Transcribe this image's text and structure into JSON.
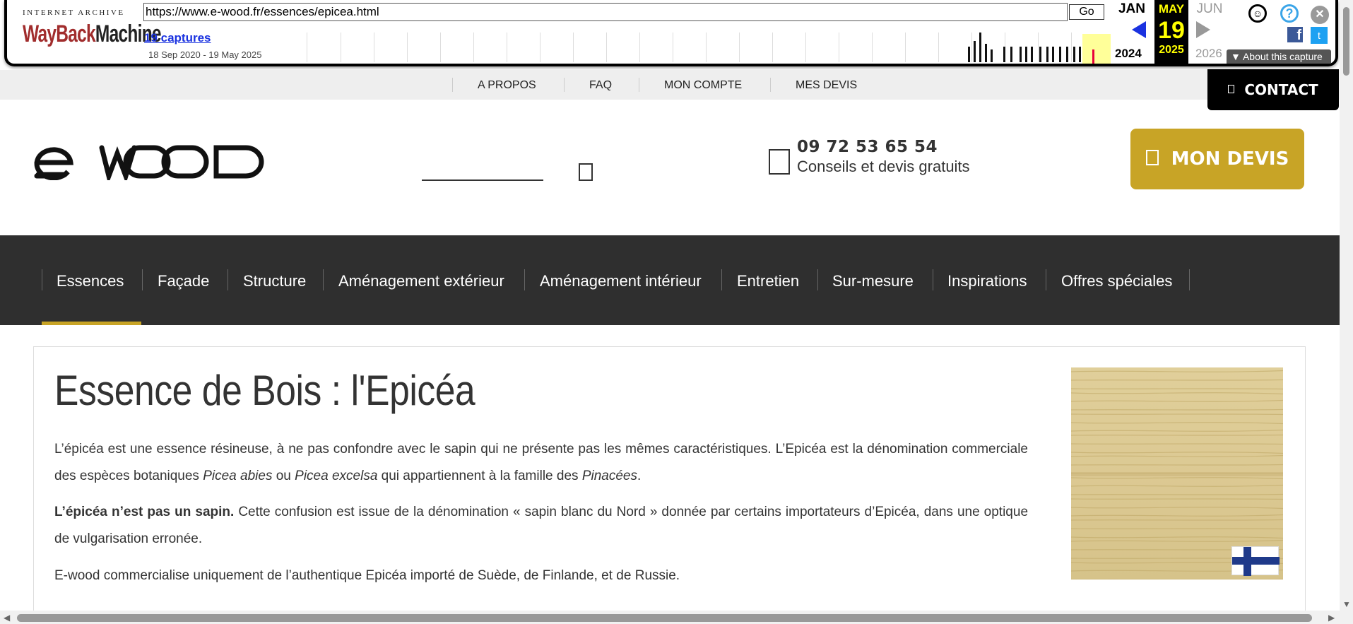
{
  "wayback": {
    "logo_top": "INTERNET ARCHIVE",
    "logo_a": "WayBack",
    "logo_b": "Machine",
    "url": "https://www.e-wood.fr/essences/epicea.html",
    "go_label": "Go",
    "captures": "19 captures",
    "range": "18 Sep 2020 - 19 May 2025",
    "month_prev": "JAN",
    "month_cur": "MAY",
    "month_next": "JUN",
    "day_cur": "19",
    "year_prev": "2024",
    "year_cur": "2025",
    "year_next": "2026",
    "about": "▼ About this capture",
    "fb": "f",
    "tw": "t",
    "help": "?",
    "close": "✕",
    "user": "☺"
  },
  "topbar": {
    "links": [
      "A PROPOS",
      "FAQ",
      "MON COMPTE",
      "MES DEVIS"
    ],
    "contact": "CONTACT"
  },
  "header": {
    "phone": "09 72 53 65 54",
    "phone_sub": "Conseils et devis gratuits",
    "devis": "MON DEVIS"
  },
  "nav": {
    "items": [
      "Essences",
      "Façade",
      "Structure",
      "Aménagement extérieur",
      "Aménagement intérieur",
      "Entretien",
      "Sur-mesure",
      "Inspirations",
      "Offres spéciales"
    ]
  },
  "content": {
    "title": "Essence de Bois : l'Epicéa",
    "p1_a": "L’épicéa est une essence résineuse, à ne pas confondre avec le sapin qui ne présente pas les mêmes caractéristiques. L’Epicéa est la dénomination commerciale des espèces botaniques ",
    "p1_b": "Picea abies",
    "p1_c": " ou ",
    "p1_d": "Picea excelsa",
    "p1_e": " qui appartiennent à la famille des ",
    "p1_f": "Pinacées",
    "p1_g": ".",
    "p2_strong": "L’épicéa n’est pas un sapin.",
    "p2_rest": " Cette confusion est issue de la dénomination « sapin blanc du Nord » donnée par certains importateurs d’Epicéa, dans une optique de vulgarisation erronée.",
    "p3": "E-wood commercialise uniquement de l’authentique Epicéa importé de Suède, de Finlande, et de Russie."
  },
  "colors": {
    "accent": "#c8a426",
    "nav_bg": "#2f2f2f"
  }
}
